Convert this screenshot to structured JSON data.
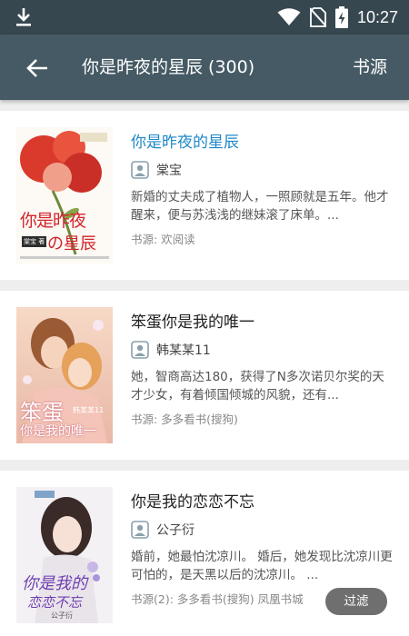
{
  "status_bar": {
    "time": "10:27",
    "icons": [
      "download-icon",
      "wifi-icon",
      "no-sim-icon",
      "battery-charging-icon"
    ]
  },
  "app_bar": {
    "back_icon": "arrow-left-icon",
    "title": "你是昨夜的星辰 (300)",
    "source_label": "书源"
  },
  "results": [
    {
      "title": "你是昨夜的星辰",
      "highlighted": true,
      "author": "棠宝",
      "description": "新婚的丈夫成了植物人，一照顾就是五年。他才醒来，便与苏浅浅的继妹滚了床单。...",
      "source": "书源: 欢阅读",
      "cover_text": [
        "你是昨夜",
        "の星辰"
      ],
      "cover_badge": "棠宝 著"
    },
    {
      "title": "笨蛋你是我的唯一",
      "highlighted": false,
      "author": "韩某某11",
      "description": "她，智商高达180，获得了N多次诺贝尔奖的天才少女，有着倾国倾城的风貌，还有...",
      "source": "书源: 多多看书(搜狗)",
      "cover_text": [
        "笨蛋",
        "你是我的唯一"
      ],
      "cover_badge": "韩某某11"
    },
    {
      "title": "你是我的恋恋不忘",
      "highlighted": false,
      "author": "公子衍",
      "description": "婚前，她最怕沈凉川。 婚后，她发现比沈凉川更可怕的，是天黑以后的沈凉川。 ...",
      "source": "书源(2): 多多看书(搜狗) 凤凰书城",
      "cover_text": [
        "你是我的",
        "恋恋不忘"
      ],
      "cover_badge": "公子衍"
    }
  ],
  "filter_button": "过滤",
  "colors": {
    "status_bar": "#37474f",
    "app_bar": "#455a64",
    "highlight_title": "#1e88c8",
    "filter_button": "#6f6f6f"
  }
}
